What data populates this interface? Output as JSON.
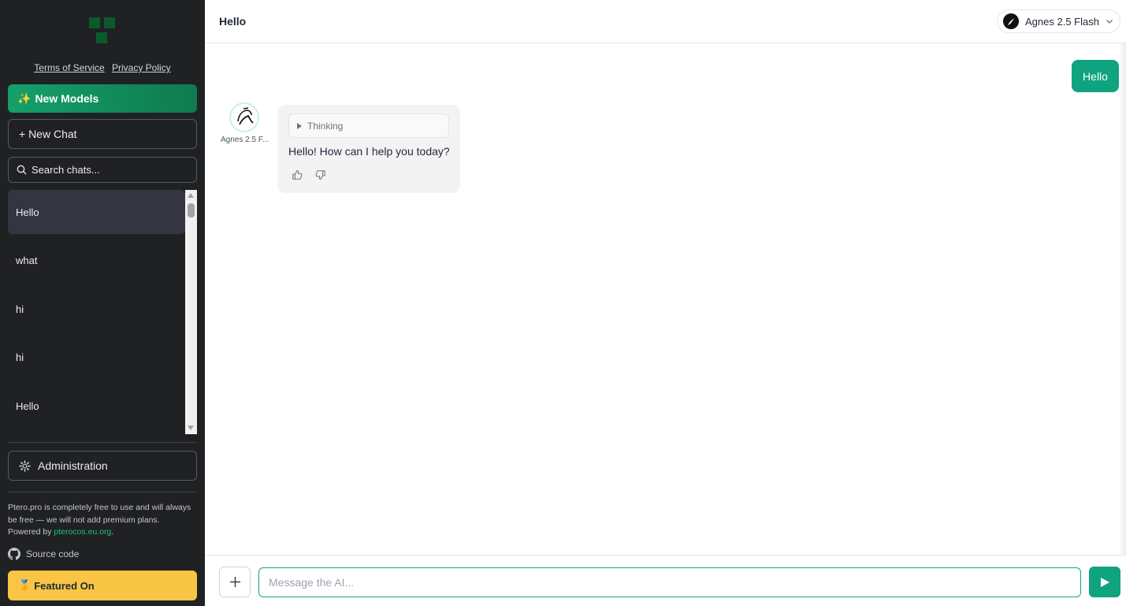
{
  "sidebar": {
    "legal": {
      "terms": "Terms of Service",
      "privacy": "Privacy Policy"
    },
    "new_models": {
      "emoji": "✨",
      "label": "New Models"
    },
    "new_chat": "+ New Chat",
    "search_placeholder": "Search chats...",
    "chats": [
      {
        "title": "Hello",
        "active": true
      },
      {
        "title": "what",
        "active": false
      },
      {
        "title": "hi",
        "active": false
      },
      {
        "title": "hi",
        "active": false
      },
      {
        "title": "Hello",
        "active": false
      }
    ],
    "admin": "Administration",
    "footer": {
      "note": "Ptero.pro is completely free to use and will always be free — we will not add premium plans.",
      "powered_by": "Powered by",
      "powered_link": "pterocos.eu.org",
      "powered_suffix": "."
    },
    "source": "Source code",
    "featured": {
      "emoji": "🏅",
      "label": "Featured On"
    }
  },
  "header": {
    "title": "Hello",
    "model": "Agnes 2.5 Flash"
  },
  "messages": {
    "user": "Hello",
    "bot_name": "Agnes 2.5 F...",
    "thinking": "Thinking",
    "bot": "Hello! How can I help you today?"
  },
  "composer": {
    "placeholder": "Message the AI..."
  },
  "colors": {
    "sidebar_bg": "#202123",
    "accent": "#10a37f",
    "active_chat": "#343541",
    "featured": "#f8c545",
    "logo": "#0c5a2c"
  }
}
